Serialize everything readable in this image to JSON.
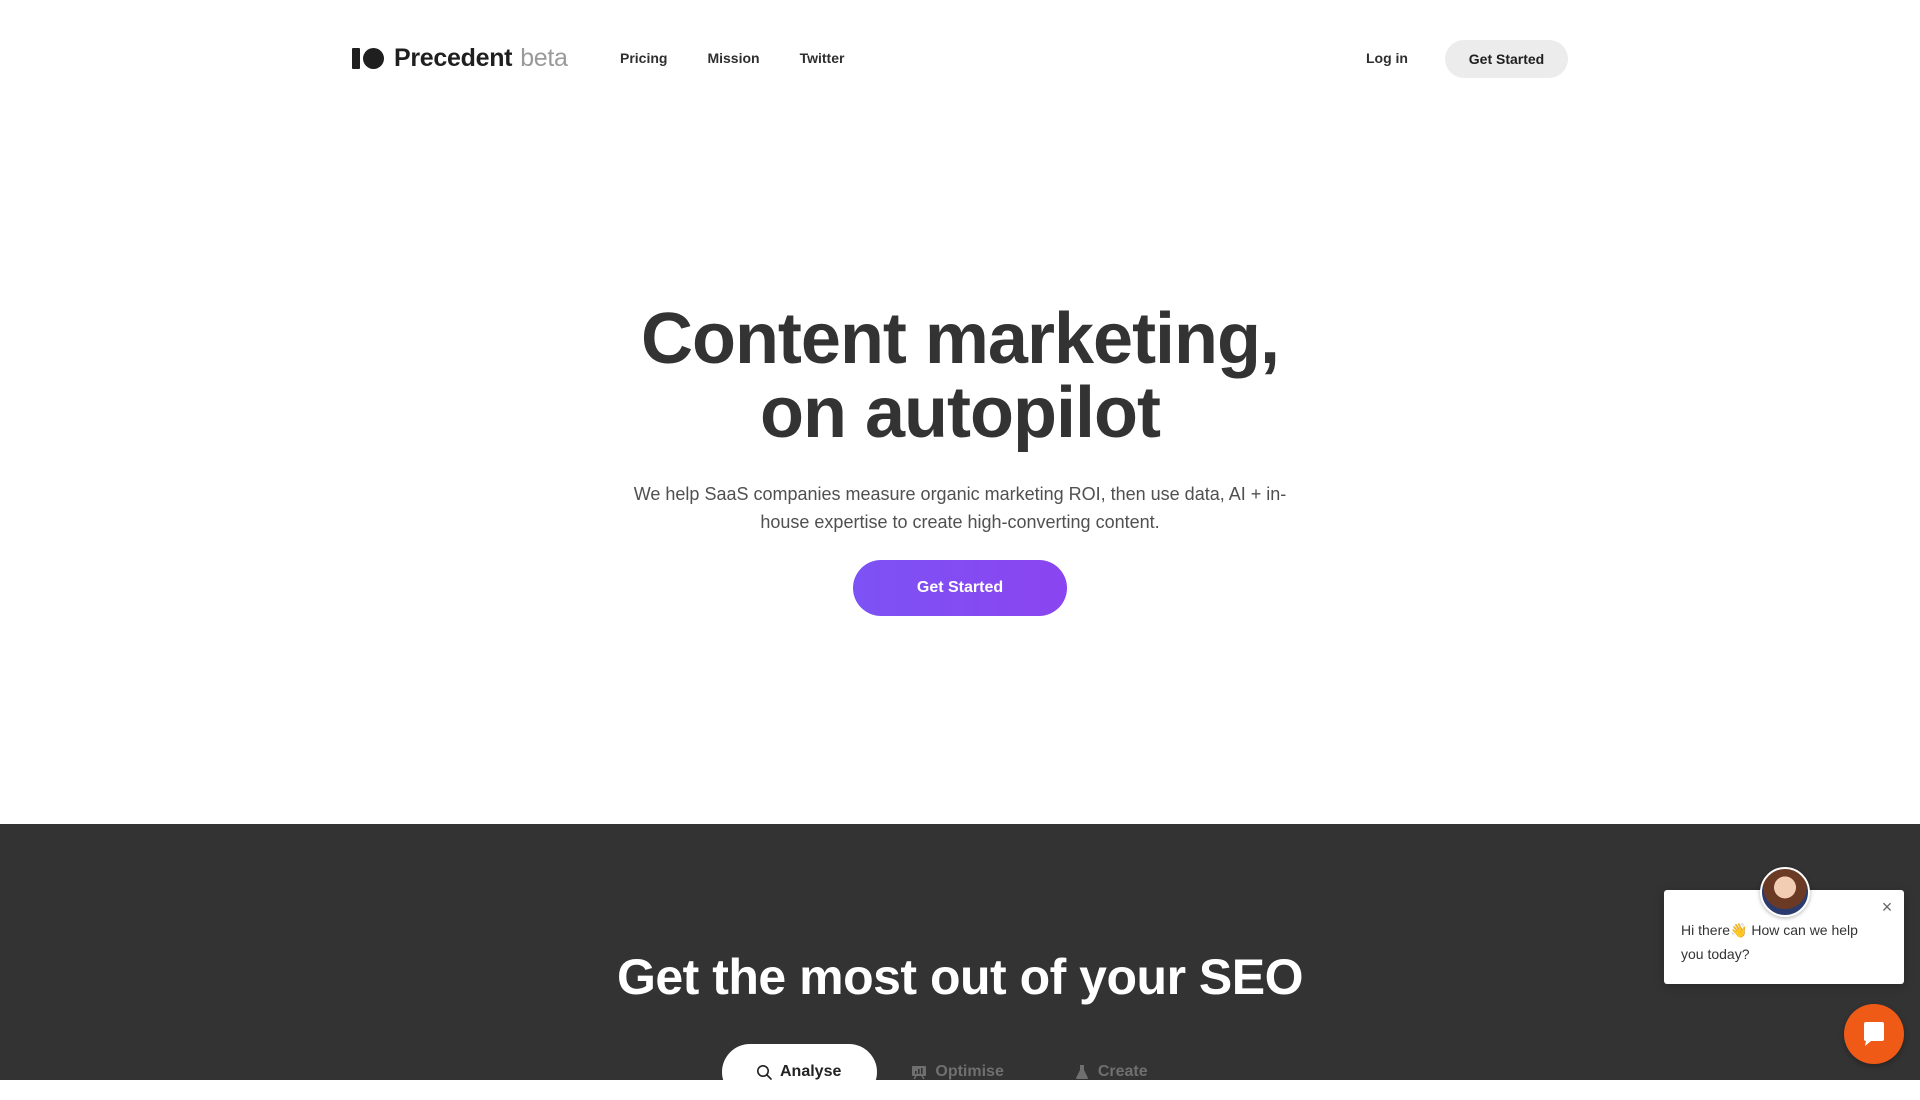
{
  "header": {
    "logo_name": "Precedent",
    "logo_beta": "beta",
    "nav": [
      "Pricing",
      "Mission",
      "Twitter"
    ],
    "login": "Log in",
    "cta": "Get Started"
  },
  "hero": {
    "title_line1": "Content marketing,",
    "title_line2": "on autopilot",
    "subtitle": "We help SaaS companies measure organic marketing ROI, then use data, AI + in-house expertise to create high-converting content.",
    "cta": "Get Started",
    "cta_color": "#8b5cf6"
  },
  "features": {
    "title": "Get the most out of your SEO",
    "tabs": [
      {
        "label": "Analyse",
        "icon": "search-icon",
        "active": true
      },
      {
        "label": "Optimise",
        "icon": "chart-icon",
        "active": false
      },
      {
        "label": "Create",
        "icon": "flask-icon",
        "active": false
      }
    ],
    "background": "#333333"
  },
  "chat": {
    "message": "Hi there👋 How can we help you today?",
    "launcher_color": "#f05a17"
  }
}
